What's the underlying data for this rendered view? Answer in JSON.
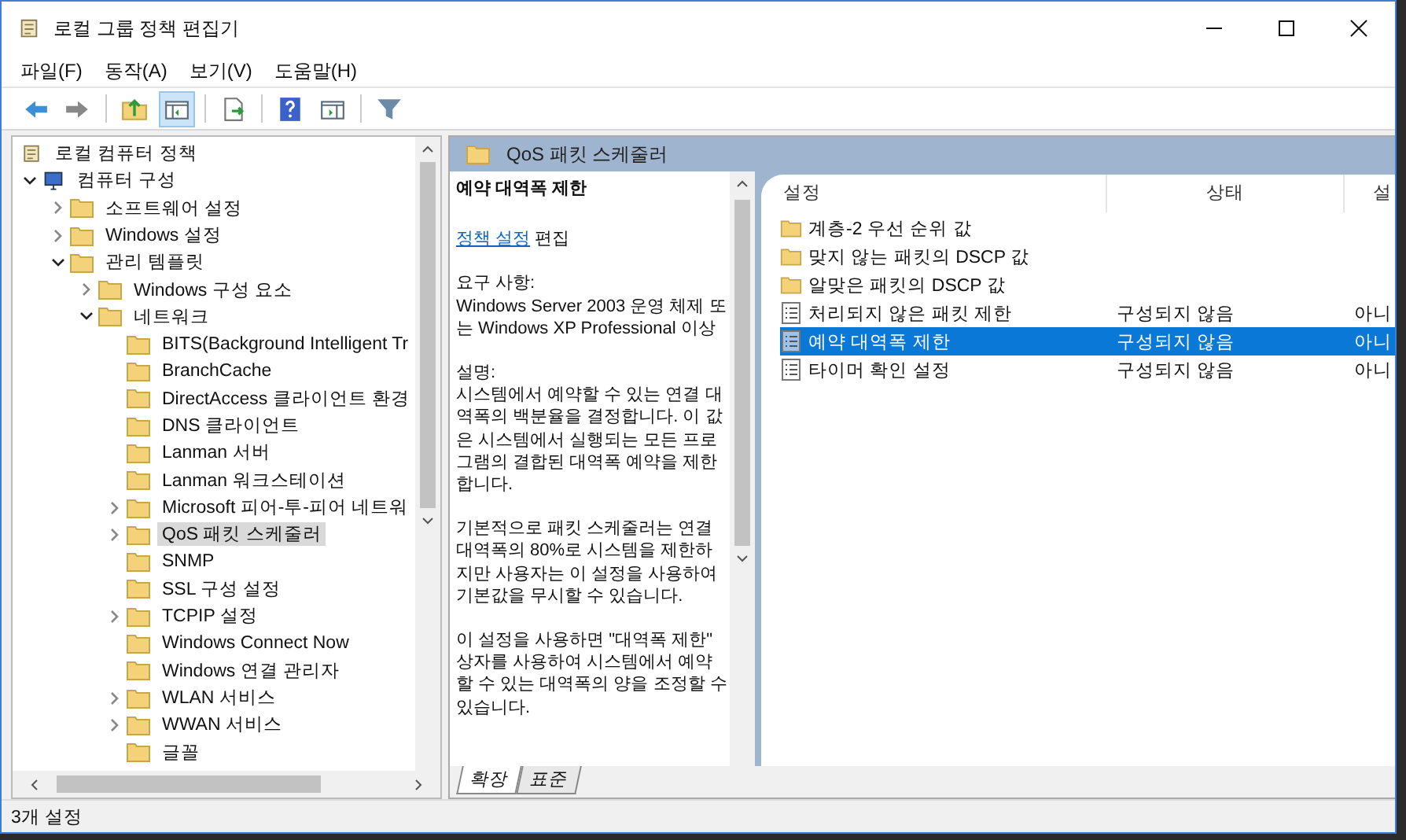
{
  "window": {
    "title": "로컬 그룹 정책 편집기"
  },
  "menu": [
    "파일(F)",
    "동작(A)",
    "보기(V)",
    "도움말(H)"
  ],
  "toolbar": [
    {
      "kind": "back",
      "pressed": false
    },
    {
      "kind": "forward",
      "pressed": false
    },
    {
      "kind": "separator"
    },
    {
      "kind": "up",
      "pressed": false
    },
    {
      "kind": "tree",
      "pressed": true
    },
    {
      "kind": "separator"
    },
    {
      "kind": "export",
      "pressed": false
    },
    {
      "kind": "separator"
    },
    {
      "kind": "help",
      "pressed": false
    },
    {
      "kind": "pane",
      "pressed": false
    },
    {
      "kind": "separator"
    },
    {
      "kind": "filter",
      "pressed": false
    }
  ],
  "tree": [
    {
      "label": "로컬 컴퓨터 정책",
      "kind": "policy",
      "selected": false,
      "children": [
        {
          "label": "컴퓨터 구성",
          "kind": "computer",
          "expanded": true,
          "selected": false,
          "children": [
            {
              "label": "소프트웨어 설정",
              "kind": "folder",
              "expanded": false,
              "selected": false
            },
            {
              "label": "Windows 설정",
              "kind": "folder",
              "expanded": false,
              "selected": false
            },
            {
              "label": "관리 템플릿",
              "kind": "folder",
              "expanded": true,
              "selected": false,
              "children": [
                {
                  "label": "Windows 구성 요소",
                  "kind": "folder",
                  "expanded": false,
                  "selected": false
                },
                {
                  "label": "네트워크",
                  "kind": "folder",
                  "expanded": true,
                  "selected": false,
                  "children": [
                    {
                      "label": "BITS(Background Intelligent Tr",
                      "kind": "folder",
                      "selected": false
                    },
                    {
                      "label": "BranchCache",
                      "kind": "folder",
                      "selected": false
                    },
                    {
                      "label": "DirectAccess 클라이언트 환경",
                      "kind": "folder",
                      "selected": false
                    },
                    {
                      "label": "DNS 클라이언트",
                      "kind": "folder",
                      "selected": false
                    },
                    {
                      "label": "Lanman 서버",
                      "kind": "folder",
                      "selected": false
                    },
                    {
                      "label": "Lanman 워크스테이션",
                      "kind": "folder",
                      "selected": false
                    },
                    {
                      "label": "Microsoft 피어-투-피어 네트워",
                      "kind": "folder",
                      "expanded": false,
                      "selected": false
                    },
                    {
                      "label": "QoS 패킷 스케줄러",
                      "kind": "folder",
                      "expanded": false,
                      "selected": true
                    },
                    {
                      "label": "SNMP",
                      "kind": "folder",
                      "selected": false
                    },
                    {
                      "label": "SSL 구성 설정",
                      "kind": "folder",
                      "selected": false
                    },
                    {
                      "label": "TCPIP 설정",
                      "kind": "folder",
                      "expanded": false,
                      "selected": false
                    },
                    {
                      "label": "Windows Connect Now",
                      "kind": "folder",
                      "selected": false
                    },
                    {
                      "label": "Windows 연결 관리자",
                      "kind": "folder",
                      "selected": false
                    },
                    {
                      "label": "WLAN 서비스",
                      "kind": "folder",
                      "expanded": false,
                      "selected": false
                    },
                    {
                      "label": "WWAN 서비스",
                      "kind": "folder",
                      "expanded": false,
                      "selected": false
                    },
                    {
                      "label": "글꼴",
                      "kind": "folder",
                      "selected": false
                    }
                  ]
                }
              ]
            }
          ]
        }
      ]
    }
  ],
  "header": {
    "title": "QoS 패킷 스케줄러"
  },
  "description": {
    "title": "예약 대역폭 제한",
    "edit_link": "정책 설정",
    "edit_suffix": "편집",
    "paragraphs": [
      "요구 사항:",
      "Windows Server 2003 운영 체제 또는 Windows XP Professional 이상",
      "설명:",
      "시스템에서 예약할 수 있는 연결 대역폭의 백분율을 결정합니다. 이 값은 시스템에서 실행되는 모든 프로그램의 결합된 대역폭 예약을 제한합니다.",
      "기본적으로 패킷 스케줄러는 연결 대역폭의 80%로 시스템을 제한하지만 사용자는 이 설정을 사용하여 기본값을 무시할 수 있습니다.",
      "이 설정을 사용하면 \"대역폭 제한\" 상자를 사용하여 시스템에서 예약할 수 있는 대역폭의 양을 조정할 수 있습니다."
    ]
  },
  "table": {
    "columns": [
      "설정",
      "상태",
      "설"
    ],
    "rows": [
      {
        "kind": "folder",
        "selected": false,
        "cells": [
          "계층-2 우선 순위 값"
        ]
      },
      {
        "kind": "folder",
        "selected": false,
        "cells": [
          "맞지 않는 패킷의 DSCP 값"
        ]
      },
      {
        "kind": "folder",
        "selected": false,
        "cells": [
          "알맞은 패킷의 DSCP 값"
        ]
      },
      {
        "kind": "setting",
        "selected": false,
        "cells": [
          "처리되지 않은 패킷 제한",
          "구성되지 않음",
          "아니"
        ]
      },
      {
        "kind": "setting",
        "selected": true,
        "cells": [
          "예약 대역폭 제한",
          "구성되지 않음",
          "아니"
        ]
      },
      {
        "kind": "setting",
        "selected": false,
        "cells": [
          "타이머 확인 설정",
          "구성되지 않음",
          "아니"
        ]
      }
    ]
  },
  "view_tabs": [
    {
      "label": "확장",
      "selected": true
    },
    {
      "label": "표준",
      "selected": false
    }
  ],
  "status_bar": "3개 설정"
}
